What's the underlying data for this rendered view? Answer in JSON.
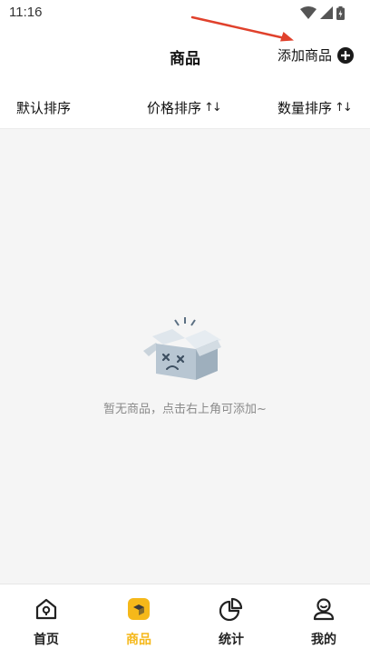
{
  "status_bar": {
    "time": "11:16"
  },
  "header": {
    "title": "商品",
    "add_label": "添加商品"
  },
  "sort_bar": {
    "items": [
      {
        "label": "默认排序",
        "arrows": ""
      },
      {
        "label": "价格排序",
        "arrows": "↑↓"
      },
      {
        "label": "数量排序",
        "arrows": "↑↓"
      }
    ]
  },
  "empty_state": {
    "message": "暂无商品，点击右上角可添加~"
  },
  "tabbar": {
    "tabs": [
      {
        "label": "首页",
        "icon": "home-icon",
        "active": false
      },
      {
        "label": "商品",
        "icon": "product-box-icon",
        "active": true
      },
      {
        "label": "统计",
        "icon": "pie-chart-icon",
        "active": false
      },
      {
        "label": "我的",
        "icon": "user-icon",
        "active": false
      }
    ]
  },
  "colors": {
    "accent": "#f5b81a",
    "arrow": "#e0412c",
    "background": "#f5f5f5"
  }
}
